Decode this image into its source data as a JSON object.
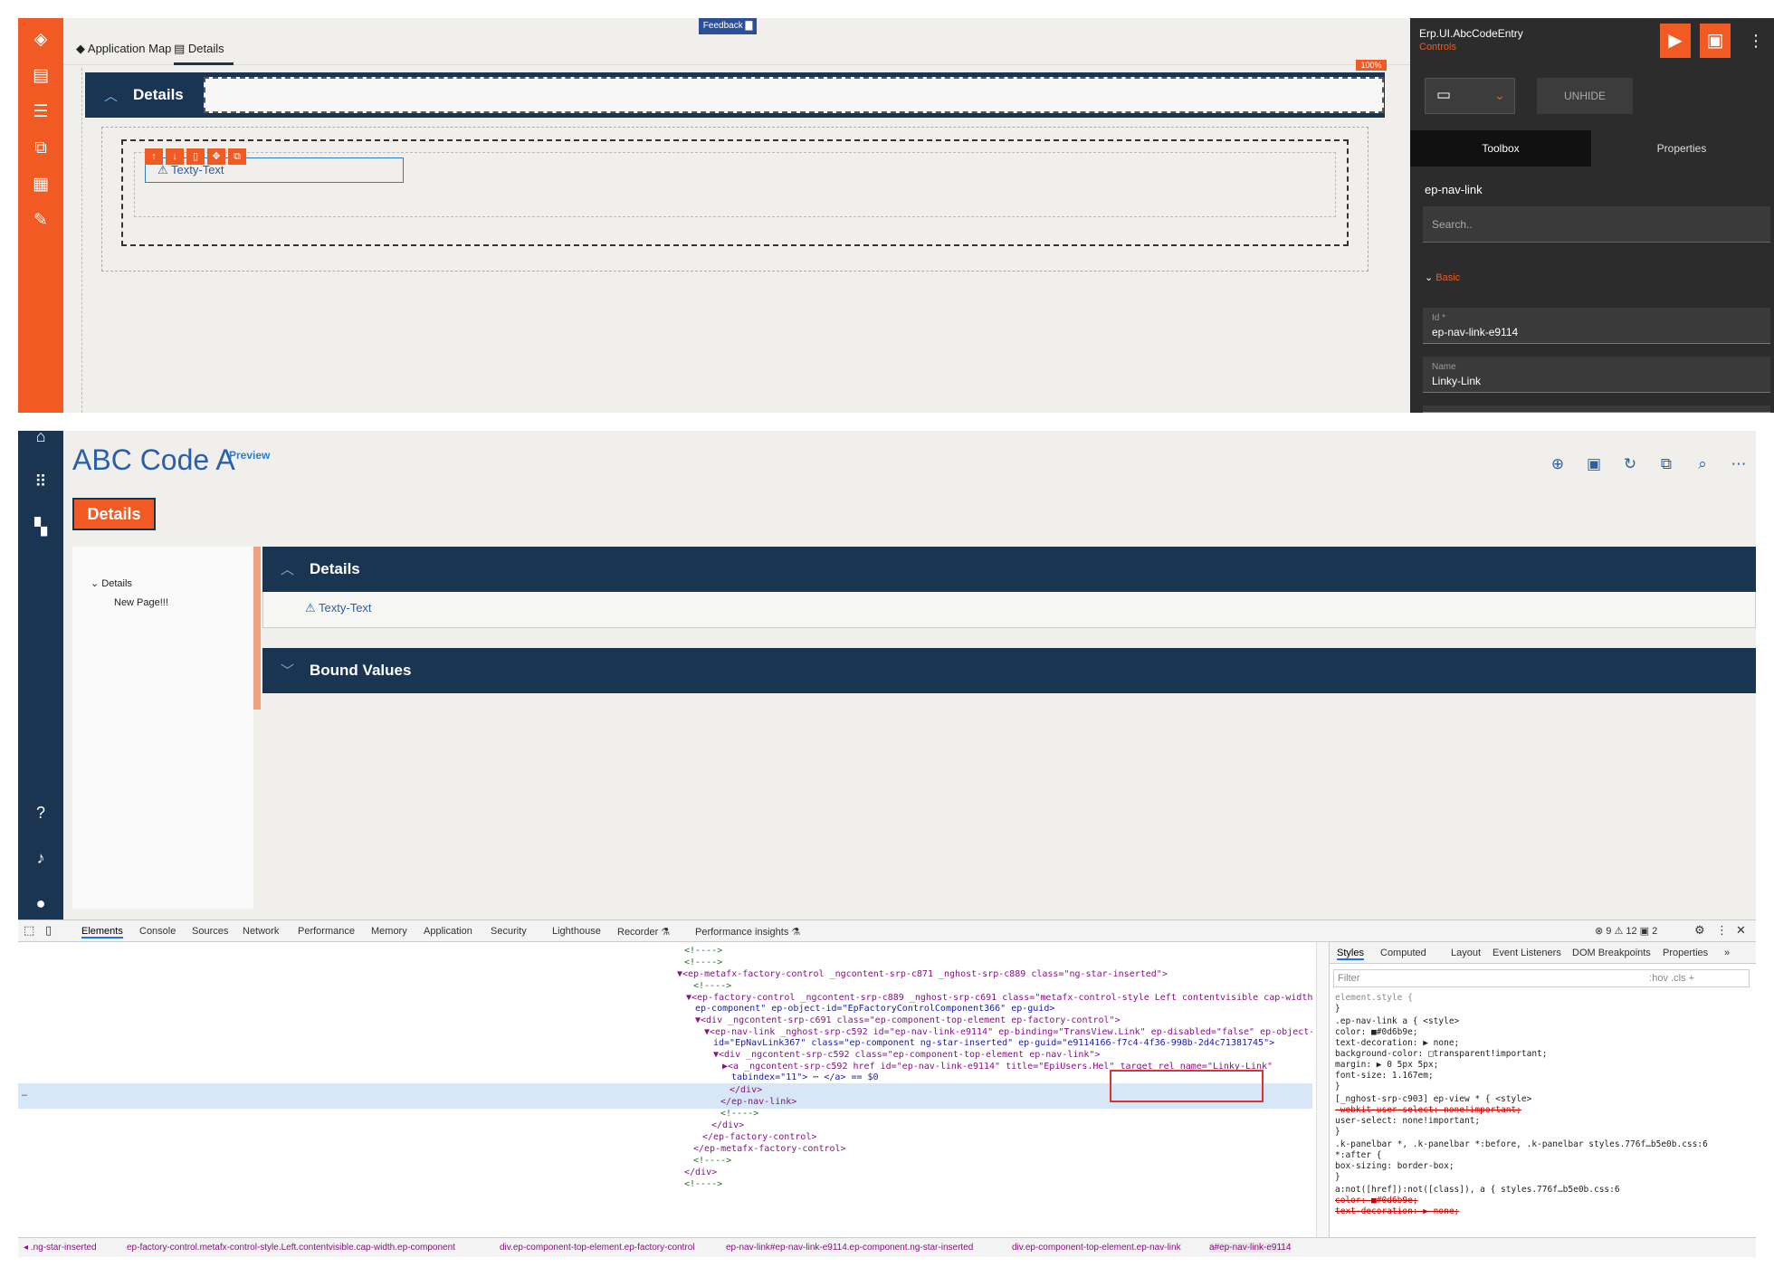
{
  "designer": {
    "tabs": [
      {
        "label": "Application Map"
      },
      {
        "label": "Details"
      }
    ],
    "feedback_label": "Feedback",
    "panel_title": "Details",
    "pct_badge": "100%",
    "control_label": "Texty-Text",
    "props": {
      "title": "Erp.UI.AbcCodeEntry",
      "subtitle": "Controls",
      "unhide_label": "UNHIDE",
      "tabs": [
        {
          "label": "Toolbox"
        },
        {
          "label": "Properties"
        }
      ],
      "component_name": "ep-nav-link",
      "search_placeholder": "Search..",
      "section_basic": "Basic",
      "fields": [
        {
          "label": "Id *",
          "value": "ep-nav-link-e9114"
        },
        {
          "label": "Name",
          "value": "Linky-Link"
        }
      ]
    }
  },
  "runtime": {
    "title": "ABC Code A",
    "preview_label": "Preview",
    "details_button": "Details",
    "tree": {
      "root": "Details",
      "child": "New Page!!!"
    },
    "panel1_title": "Details",
    "link_text": "Texty-Text",
    "panel2_title": "Bound Values"
  },
  "devtools": {
    "tabs": [
      {
        "label": "Elements"
      },
      {
        "label": "Console"
      },
      {
        "label": "Sources"
      },
      {
        "label": "Network"
      },
      {
        "label": "Performance"
      },
      {
        "label": "Memory"
      },
      {
        "label": "Application"
      },
      {
        "label": "Security"
      },
      {
        "label": "Lighthouse"
      },
      {
        "label": "Recorder ⚗"
      },
      {
        "label": "Performance insights ⚗"
      }
    ],
    "counts": "⊗ 9  ⚠ 12  ▣ 2",
    "code_lines": [
      "<!---->",
      "<!---->",
      "▼<ep-metafx-factory-control _ngcontent-srp-c871 _nghost-srp-c889 class=\"ng-star-inserted\">",
      "<!---->",
      "▼<ep-factory-control _ngcontent-srp-c889 _nghost-srp-c691 class=\"metafx-control-style Left contentvisible cap-width",
      "ep-component\" ep-object-id=\"EpFactoryControlComponent366\" ep-guid>",
      "▼<div _ngcontent-srp-c691 class=\"ep-component-top-element ep-factory-control\">",
      "▼<ep-nav-link _nghost-srp-c592 id=\"ep-nav-link-e9114\" ep-binding=\"TransView.Link\" ep-disabled=\"false\" ep-object-",
      "id=\"EpNavLink367\" class=\"ep-component ng-star-inserted\" ep-guid=\"e9114166-f7c4-4f36-998b-2d4c71381745\">",
      "▼<div _ngcontent-srp-c592 class=\"ep-component-top-element ep-nav-link\">",
      "▶<a _ngcontent-srp-c592 href id=\"ep-nav-link-e9114\" title=\"EpiUsers.Hel\" target rel name=\"Linky-Link\"",
      "tabindex=\"11\"> ⋯ </a> == $0",
      "</div>",
      "</ep-nav-link>",
      "<!---->",
      "</div>",
      "</ep-factory-control>",
      "</ep-metafx-factory-control>",
      "<!---->",
      "</div>",
      "<!---->"
    ],
    "style_tabs": [
      {
        "label": "Styles"
      },
      {
        "label": "Computed"
      },
      {
        "label": "Layout"
      },
      {
        "label": "Event Listeners"
      },
      {
        "label": "DOM Breakpoints"
      },
      {
        "label": "Properties"
      },
      {
        "label": "»"
      }
    ],
    "filter_placeholder": "Filter",
    "filter_right": ":hov  .cls  +",
    "style_lines": [
      "element.style {",
      "}",
      ".ep-nav-link a {                                    <style>",
      "   color: ■#0d6b9e;",
      "   text-decoration: ▶ none;",
      "   background-color: □transparent!important;",
      "   margin: ▶ 0 5px 5px;",
      "   font-size: 1.167em;",
      "}",
      "[_nghost-srp-c903] ep-view * {                       <style>",
      "   -webkit-user-select: none!important;",
      "   user-select: none!important;",
      "}",
      ".k-panelbar *, .k-panelbar *:before, .k-panelbar   styles.776f…b5e0b.css:6",
      "*:after {",
      "   box-sizing: border-box;",
      "}",
      "a:not([href]):not([class]), a {              styles.776f…b5e0b.css:6",
      "   color: ■#0d6b9e;",
      "   text-decoration: ▶ none;"
    ],
    "crumbs": [
      "◂ .ng-star-inserted",
      "ep-factory-control.metafx-control-style.Left.contentvisible.cap-width.ep-component",
      "div.ep-component-top-element.ep-factory-control",
      "ep-nav-link#ep-nav-link-e9114.ep-component.ng-star-inserted",
      "div.ep-component-top-element.ep-nav-link",
      "a#ep-nav-link-e9114"
    ]
  }
}
